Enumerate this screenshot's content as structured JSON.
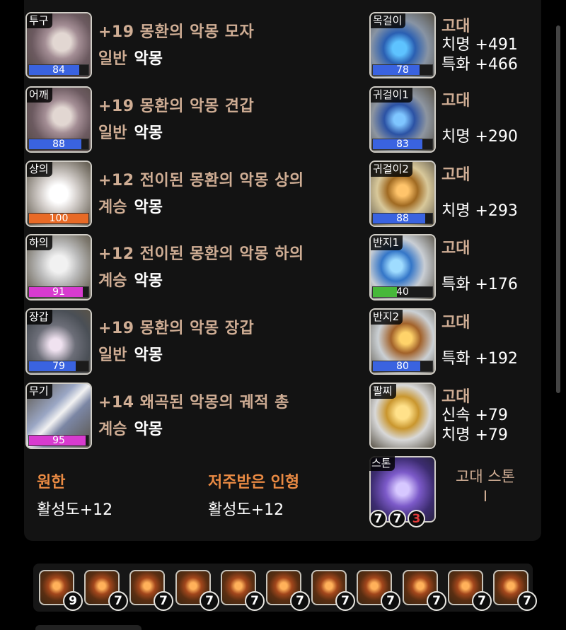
{
  "equipment": [
    {
      "slot": "투구",
      "name": "+19 몽환의 악몽 모자",
      "grade": "일반",
      "set": "악몽",
      "quality": 84,
      "quality_color": "#3a63e0",
      "art": "art-armor"
    },
    {
      "slot": "어깨",
      "name": "+19 몽환의 악몽 견갑",
      "grade": "일반",
      "set": "악몽",
      "quality": 88,
      "quality_color": "#3a63e0",
      "art": "art-armor"
    },
    {
      "slot": "상의",
      "name": "+12 전이된 몽환의 악몽 상의",
      "grade": "계승",
      "set": "악몽",
      "quality": 100,
      "quality_color": "#e86a26",
      "art": "art-chest"
    },
    {
      "slot": "하의",
      "name": "+12 전이된 몽환의 악몽 하의",
      "grade": "계승",
      "set": "악몽",
      "quality": 91,
      "quality_color": "#d83bcf",
      "art": "art-pants"
    },
    {
      "slot": "장갑",
      "name": "+19 몽환의 악몽 장갑",
      "grade": "일반",
      "set": "악몽",
      "quality": 79,
      "quality_color": "#3a63e0",
      "art": "art-glove"
    },
    {
      "slot": "무기",
      "name": "+14 왜곡된 악몽의 궤적 총",
      "grade": "계승",
      "set": "악몽",
      "quality": 95,
      "quality_color": "#d83bcf",
      "art": "art-weapon"
    }
  ],
  "accessories": [
    {
      "slot": "목걸이",
      "grade": "고대",
      "stats": [
        "치명 +491",
        "특화 +466"
      ],
      "quality": 78,
      "quality_color": "#3a63e0",
      "art": "art-necklace"
    },
    {
      "slot": "귀걸이1",
      "grade": "고대",
      "stats": [
        "치명 +290"
      ],
      "quality": 83,
      "quality_color": "#3a63e0",
      "art": "art-earring"
    },
    {
      "slot": "귀걸이2",
      "grade": "고대",
      "stats": [
        "치명 +293"
      ],
      "quality": 88,
      "quality_color": "#3a63e0",
      "art": "art-earring2"
    },
    {
      "slot": "반지1",
      "grade": "고대",
      "stats": [
        "특화 +176"
      ],
      "quality": 40,
      "quality_color": "#47b83a",
      "art": "art-ring"
    },
    {
      "slot": "반지2",
      "grade": "고대",
      "stats": [
        "특화 +192"
      ],
      "quality": 80,
      "quality_color": "#3a63e0",
      "art": "art-ring2"
    },
    {
      "slot": "팔찌",
      "grade": "고대",
      "stats": [
        "신속 +79",
        "치명 +79"
      ],
      "art": "art-bracelet"
    }
  ],
  "engravings": [
    {
      "name": "원한",
      "value": "활성도+12"
    },
    {
      "name": "저주받은 인형",
      "value": "활성도+12"
    }
  ],
  "stone": {
    "slot": "스톤",
    "label_line1": "고대 스톤",
    "label_line2": "I",
    "levels": [
      {
        "value": "7",
        "color": "#ffffff"
      },
      {
        "value": "7",
        "color": "#ffffff"
      },
      {
        "value": "3",
        "color": "#e23a3a"
      }
    ]
  },
  "gems": [
    "9",
    "7",
    "7",
    "7",
    "7",
    "7",
    "7",
    "7",
    "7",
    "7",
    "7"
  ]
}
